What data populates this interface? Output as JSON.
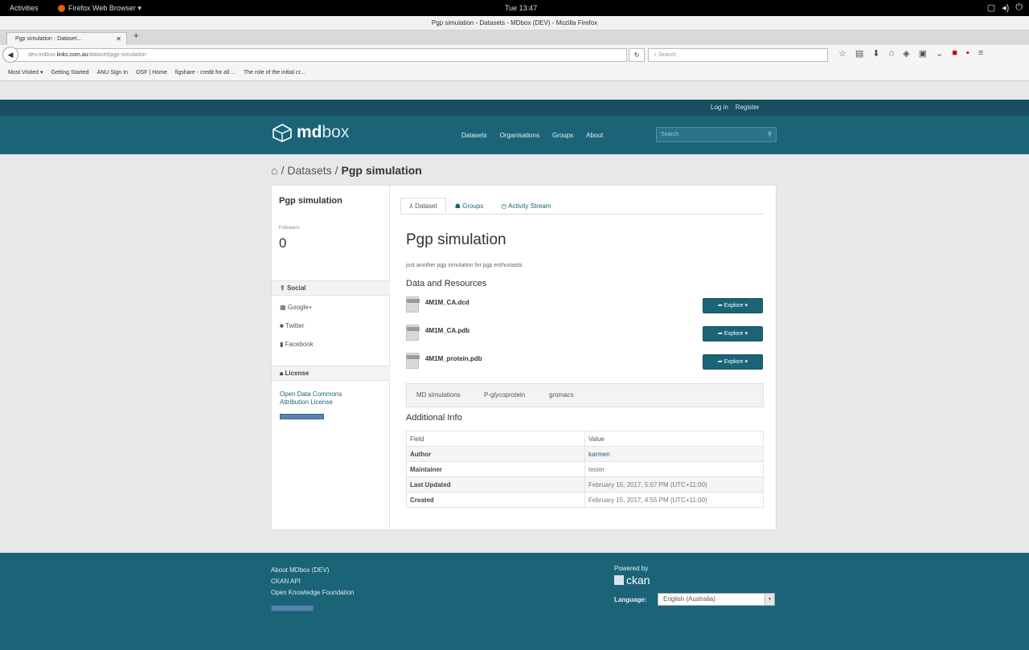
{
  "system": {
    "activities": "Activities",
    "app_menu": "Firefox Web Browser ▾",
    "clock": "Tue 13:47"
  },
  "browser": {
    "window_title": "Pgp simulation - Datasets - MDbox (DEV) - Mozilla Firefox",
    "tab_title": "Pgp simulation - Dataset...",
    "url_prefix": "dev.mdbox.",
    "url_domain": "links.com.au",
    "url_path": "/dataset/pgp-simulation",
    "search_placeholder": "Search",
    "bookmarks": [
      "Most Visited ▾",
      "Getting Started",
      "ANU Sign In",
      "OSF | Home",
      "figshare - credit for all ...",
      "The role of the initial cr..."
    ]
  },
  "header": {
    "login": "Log in",
    "register": "Register",
    "logo_bold": "md",
    "logo_light": "box",
    "nav": [
      "Datasets",
      "Organisations",
      "Groups",
      "About"
    ],
    "search_placeholder": "Search"
  },
  "breadcrumb": {
    "datasets": "Datasets",
    "current": "Pgp simulation"
  },
  "sidebar": {
    "title": "Pgp simulation",
    "followers_label": "Followers",
    "followers_count": "0",
    "social_heading": "Social",
    "social_links": [
      "Google+",
      "Twitter",
      "Facebook"
    ],
    "license_heading": "License",
    "license_line1": "Open Data Commons",
    "license_line2": "Attribution License"
  },
  "dataset": {
    "tabs": [
      "Dataset",
      "Groups",
      "Activity Stream"
    ],
    "title": "Pgp simulation",
    "notes": "just another pgp simulation for pgp enthusiasts",
    "resources_heading": "Data and Resources",
    "resources": [
      {
        "name": "4M1M_CA.dcd",
        "button": "Explore ▾"
      },
      {
        "name": "4M1M_CA.pdb",
        "button": "Explore ▾"
      },
      {
        "name": "4M1M_protein.pdb",
        "button": "Explore ▾"
      }
    ],
    "tags": [
      "MD simulations",
      "P-glycoprotein",
      "gromacs"
    ],
    "additional_heading": "Additional Info",
    "table_header": {
      "field": "Field",
      "value": "Value"
    },
    "table_rows": [
      {
        "field": "Author",
        "value": "karmen"
      },
      {
        "field": "Maintainer",
        "value": "tester"
      },
      {
        "field": "Last Updated",
        "value": "February 15, 2017, 5:07 PM (UTC+11:00)"
      },
      {
        "field": "Created",
        "value": "February 15, 2017, 4:55 PM (UTC+11:00)"
      }
    ]
  },
  "footer": {
    "links": [
      "About MDbox (DEV)",
      "CKAN API",
      "Open Knowledge Foundation"
    ],
    "powered_by": "Powered by",
    "ckan": "ckan",
    "language_label": "Language:",
    "language_value": "English (Australia)"
  },
  "colors": {
    "brand": "#1b6478",
    "brand_dark": "#164f60",
    "page_bg": "#e8e8e8"
  }
}
